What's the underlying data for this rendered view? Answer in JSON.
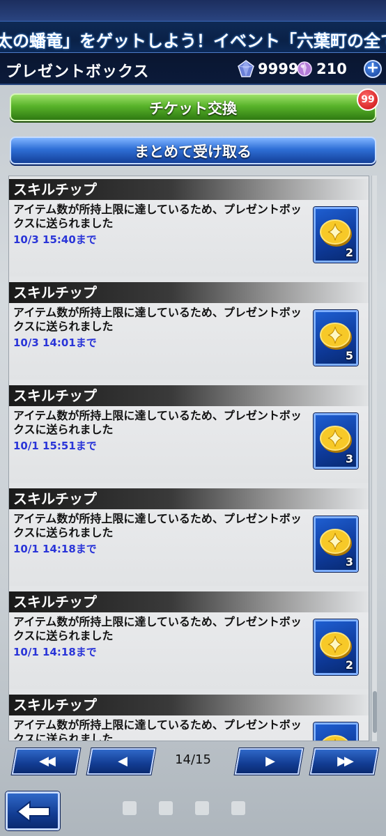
{
  "ticker": {
    "text": "太の蟠竜」をゲットしよう！イベント「六葉町の全ては私のも"
  },
  "header": {
    "title": "プレゼントボックス",
    "gems": "9999",
    "orbs": "210",
    "plus_label": "+"
  },
  "buttons": {
    "ticket_exchange": "チケット交換",
    "ticket_badge": "99",
    "receive_all": "まとめて受け取る"
  },
  "items": [
    {
      "name": "スキルチップ",
      "desc": "アイテム数が所持上限に達しているため、プレゼントボックスに送られました",
      "expires": "10/3 15:40まで",
      "count": "2"
    },
    {
      "name": "スキルチップ",
      "desc": "アイテム数が所持上限に達しているため、プレゼントボックスに送られました",
      "expires": "10/3 14:01まで",
      "count": "5"
    },
    {
      "name": "スキルチップ",
      "desc": "アイテム数が所持上限に達しているため、プレゼントボックスに送られました",
      "expires": "10/1 15:51まで",
      "count": "3"
    },
    {
      "name": "スキルチップ",
      "desc": "アイテム数が所持上限に達しているため、プレゼントボックスに送られました",
      "expires": "10/1 14:18まで",
      "count": "3"
    },
    {
      "name": "スキルチップ",
      "desc": "アイテム数が所持上限に達しているため、プレゼントボックスに送られました",
      "expires": "10/1 14:18まで",
      "count": "2"
    },
    {
      "name": "スキルチップ",
      "desc": "アイテム数が所持上限に達しているため、プレゼントボックスに送られました",
      "expires": "",
      "count": ""
    }
  ],
  "pagination": {
    "first_label": "◀◀",
    "prev_label": "◀",
    "next_label": "▶",
    "last_label": "▶▶",
    "page": "14/15"
  },
  "colors": {
    "green_button": "#58b32a",
    "blue_button": "#2f6fd6",
    "expiry_text": "#2a35d8",
    "badge_red": "#c70b0b"
  },
  "icons": {
    "gem": "gem-icon",
    "orb": "orb-icon",
    "coin": "coin-icon",
    "back": "back-arrow-icon"
  }
}
